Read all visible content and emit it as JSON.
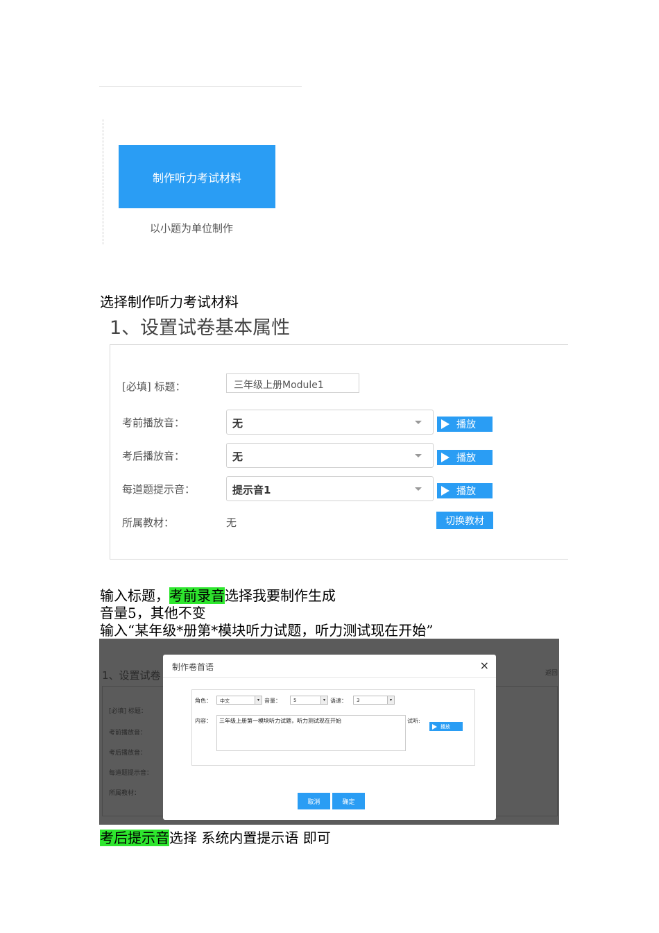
{
  "shot1": {
    "make_button": "制作听力考试材料",
    "make_subtitle": "以小题为单位制作"
  },
  "doc": {
    "line1": "选择制作听力考试材料",
    "line2_plain_a": "输入标题，",
    "line2_highlight": "考前录音",
    "line2_plain_b": "选择我要制作生成",
    "line3": "音量5，其他不变",
    "line4": "输入“某年级*册第*模块听力试题，听力测试现在开始”",
    "line5_highlight": "考后提示音",
    "line5_plain": "选择 系统内置提示语 即可"
  },
  "shot2": {
    "section_title": "1、设置试卷基本属性",
    "title_label": "[必填] 标题：",
    "title_value": "三年级上册Module1",
    "pre_label": "考前播放音：",
    "pre_value": "无",
    "post_label": "考后播放音：",
    "post_value": "无",
    "each_label": "每道题提示音：",
    "each_value": "提示音1",
    "play": "播放",
    "book_label": "所属教材：",
    "book_value": "无",
    "switch_book": "切换教材"
  },
  "shot3": {
    "bg_title": "1、设置试卷",
    "bg_back": "返回",
    "bg_labels": [
      "[必填] 标题：",
      "考前播放音：",
      "考后播放音：",
      "每道题提示音：",
      "所属教材："
    ],
    "dialog_title": "制作卷首语",
    "close": "×",
    "role_label": "角色：",
    "role_value": "中文",
    "volume_label": "音量：",
    "volume_value": "5",
    "speed_label": "语速：",
    "speed_value": "3",
    "content_label": "内容：",
    "content_value": "三年级上册第一模块听力试题，听力测试现在开始",
    "listen_label": "试听:",
    "play": "播放",
    "cancel": "取消",
    "confirm": "确定"
  },
  "colors": {
    "accent": "#2a9df4",
    "highlight": "#2ee62e",
    "overlay": "#5b5b5b"
  }
}
